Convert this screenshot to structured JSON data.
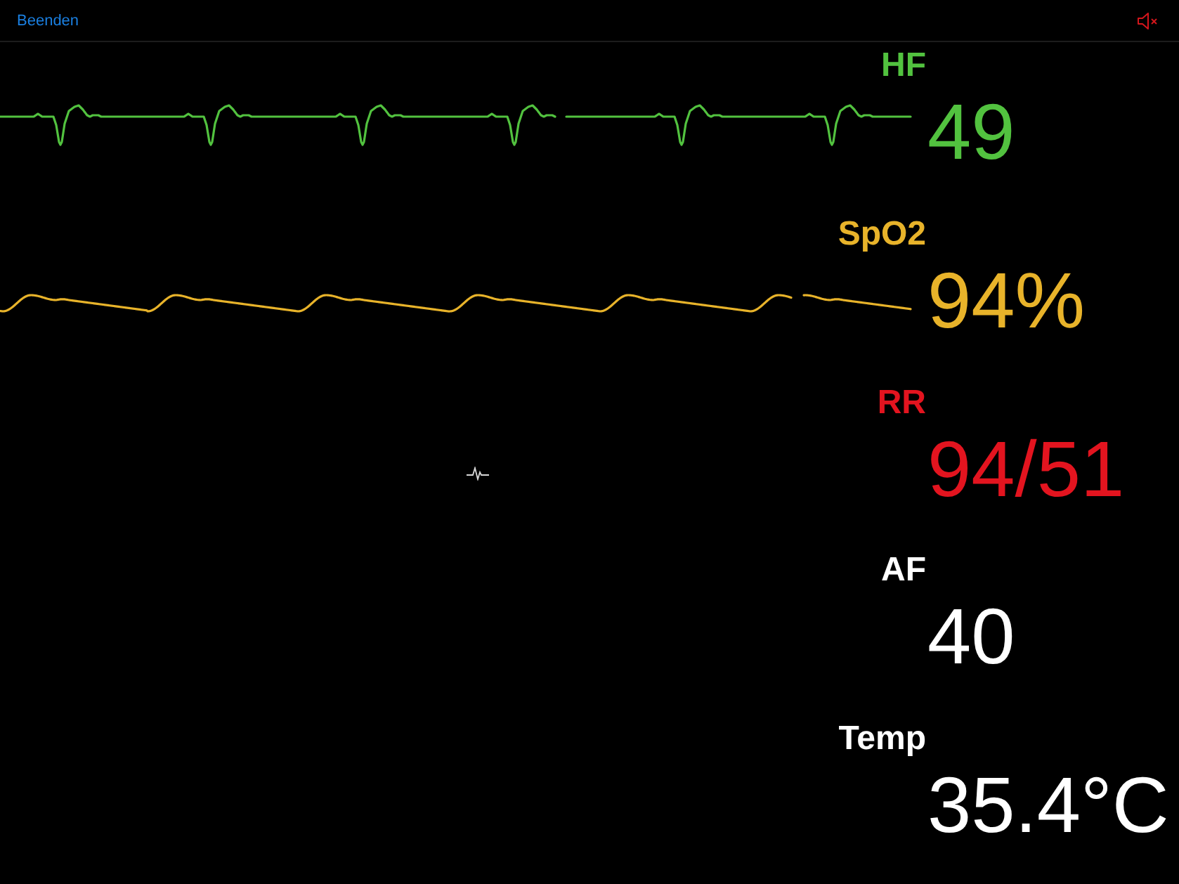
{
  "top_bar": {
    "exit_link": "Beenden",
    "speaker": {
      "muted": true
    }
  },
  "vitals": [
    {
      "label": "HF",
      "value": "49",
      "color": "#52c23f",
      "kind": "ecg"
    },
    {
      "label": "SpO2",
      "value": "94%",
      "color": "#e8b32a",
      "kind": "pleth"
    },
    {
      "label": "RR",
      "value": "94/51",
      "color": "#e3141f",
      "kind": "numeric"
    },
    {
      "label": "AF",
      "value": "40",
      "color": "#ffffff",
      "kind": "numeric"
    },
    {
      "label": "Temp",
      "value": "35.4°C",
      "color": "#ffffff",
      "kind": "numeric"
    }
  ]
}
